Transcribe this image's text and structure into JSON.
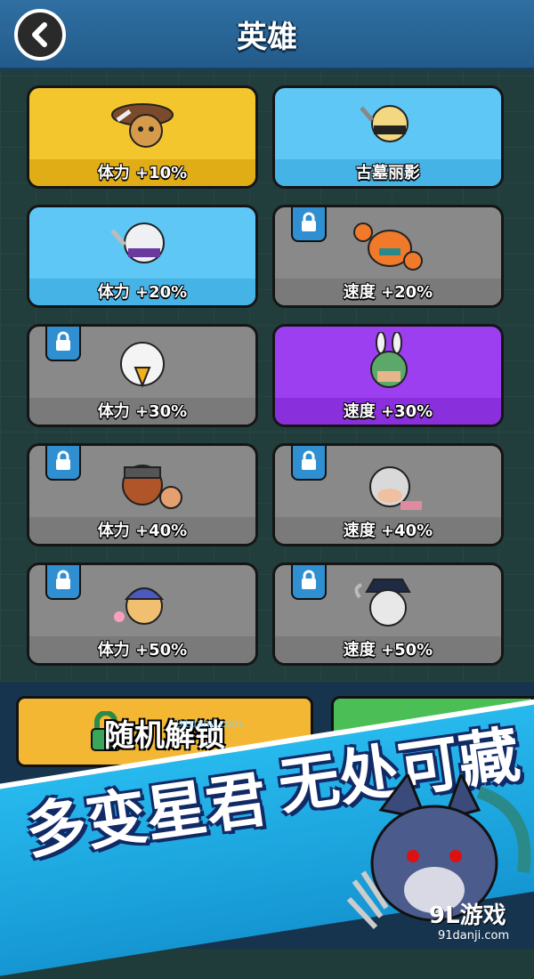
{
  "header": {
    "title": "英雄"
  },
  "heroes": [
    {
      "label": "体力 +10%",
      "color": "yellow",
      "locked": false,
      "icon": "cowboy-cat-hero-icon"
    },
    {
      "label": "古墓丽影",
      "color": "blue",
      "locked": false,
      "icon": "ninja-girl-hero-icon"
    },
    {
      "label": "体力 +20%",
      "color": "blue",
      "locked": false,
      "icon": "hooded-assassin-hero-icon"
    },
    {
      "label": "速度 +20%",
      "color": "grey",
      "locked": true,
      "icon": "crab-hero-icon"
    },
    {
      "label": "体力 +30%",
      "color": "grey",
      "locked": true,
      "icon": "eagle-hero-icon"
    },
    {
      "label": "速度 +30%",
      "color": "purple",
      "locked": false,
      "icon": "rabbit-hero-icon"
    },
    {
      "label": "体力 +40%",
      "color": "grey",
      "locked": true,
      "icon": "viking-hero-icon"
    },
    {
      "label": "速度 +40%",
      "color": "grey",
      "locked": true,
      "icon": "granny-hero-icon"
    },
    {
      "label": "体力 +50%",
      "color": "grey",
      "locked": true,
      "icon": "kid-cap-hero-icon"
    },
    {
      "label": "速度 +50%",
      "color": "grey",
      "locked": true,
      "icon": "pirate-hero-icon"
    }
  ],
  "actions": {
    "random_unlock": "随机解锁"
  },
  "promo": {
    "slogan_left": "多变星君",
    "slogan_right": "无处可藏"
  },
  "watermark": {
    "brand": "9L游戏",
    "site": "91danji.com",
    "faint": "91danji.com"
  },
  "colors": {
    "yellow": "#f4c62e",
    "blue": "#5ec7f6",
    "grey": "#898989",
    "purple": "#9c3ff0",
    "lock": "#2f8fd0"
  }
}
